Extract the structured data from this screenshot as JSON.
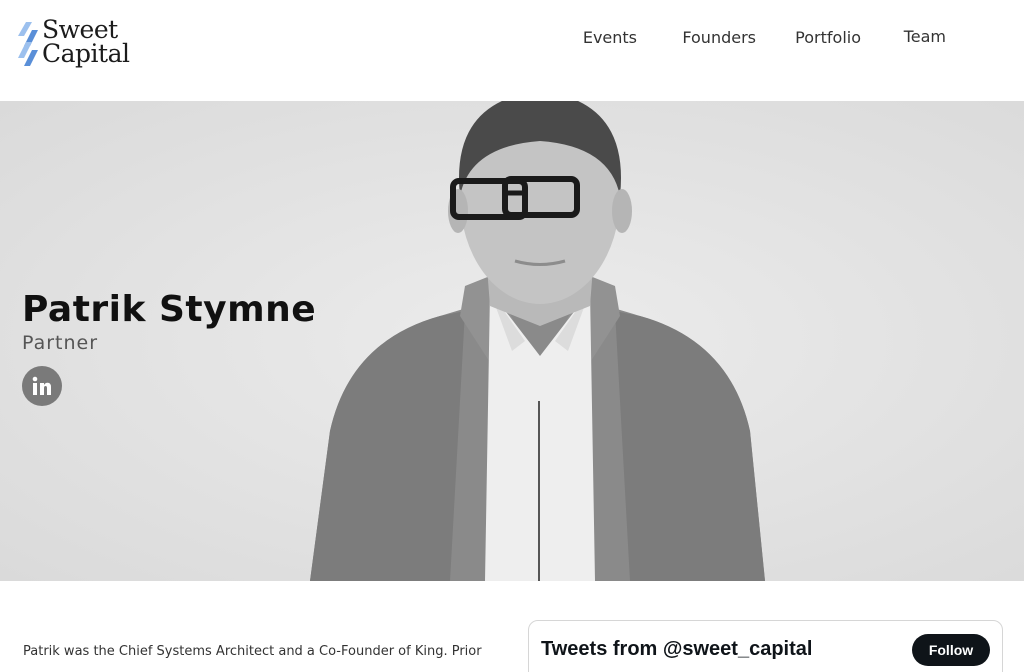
{
  "brand": {
    "name_line1": "Sweet",
    "name_line2": "Capital"
  },
  "nav": {
    "items": [
      "Events",
      "Founders",
      "Portfolio",
      "Team"
    ]
  },
  "profile": {
    "name": "Patrik Stymne",
    "role": "Partner",
    "social_icon": "linkedin-icon"
  },
  "bio": {
    "line1": "Patrik was the Chief Systems Architect and a Co-Founder of King. Prior"
  },
  "twitter": {
    "title": "Tweets from @sweet_capital",
    "follow_label": "Follow"
  },
  "colors": {
    "logo_blue": "#5a8fd8",
    "logo_light_blue": "#9cc0ee",
    "linkedin_bg": "#7a7a7a",
    "follow_bg": "#0f1419"
  }
}
